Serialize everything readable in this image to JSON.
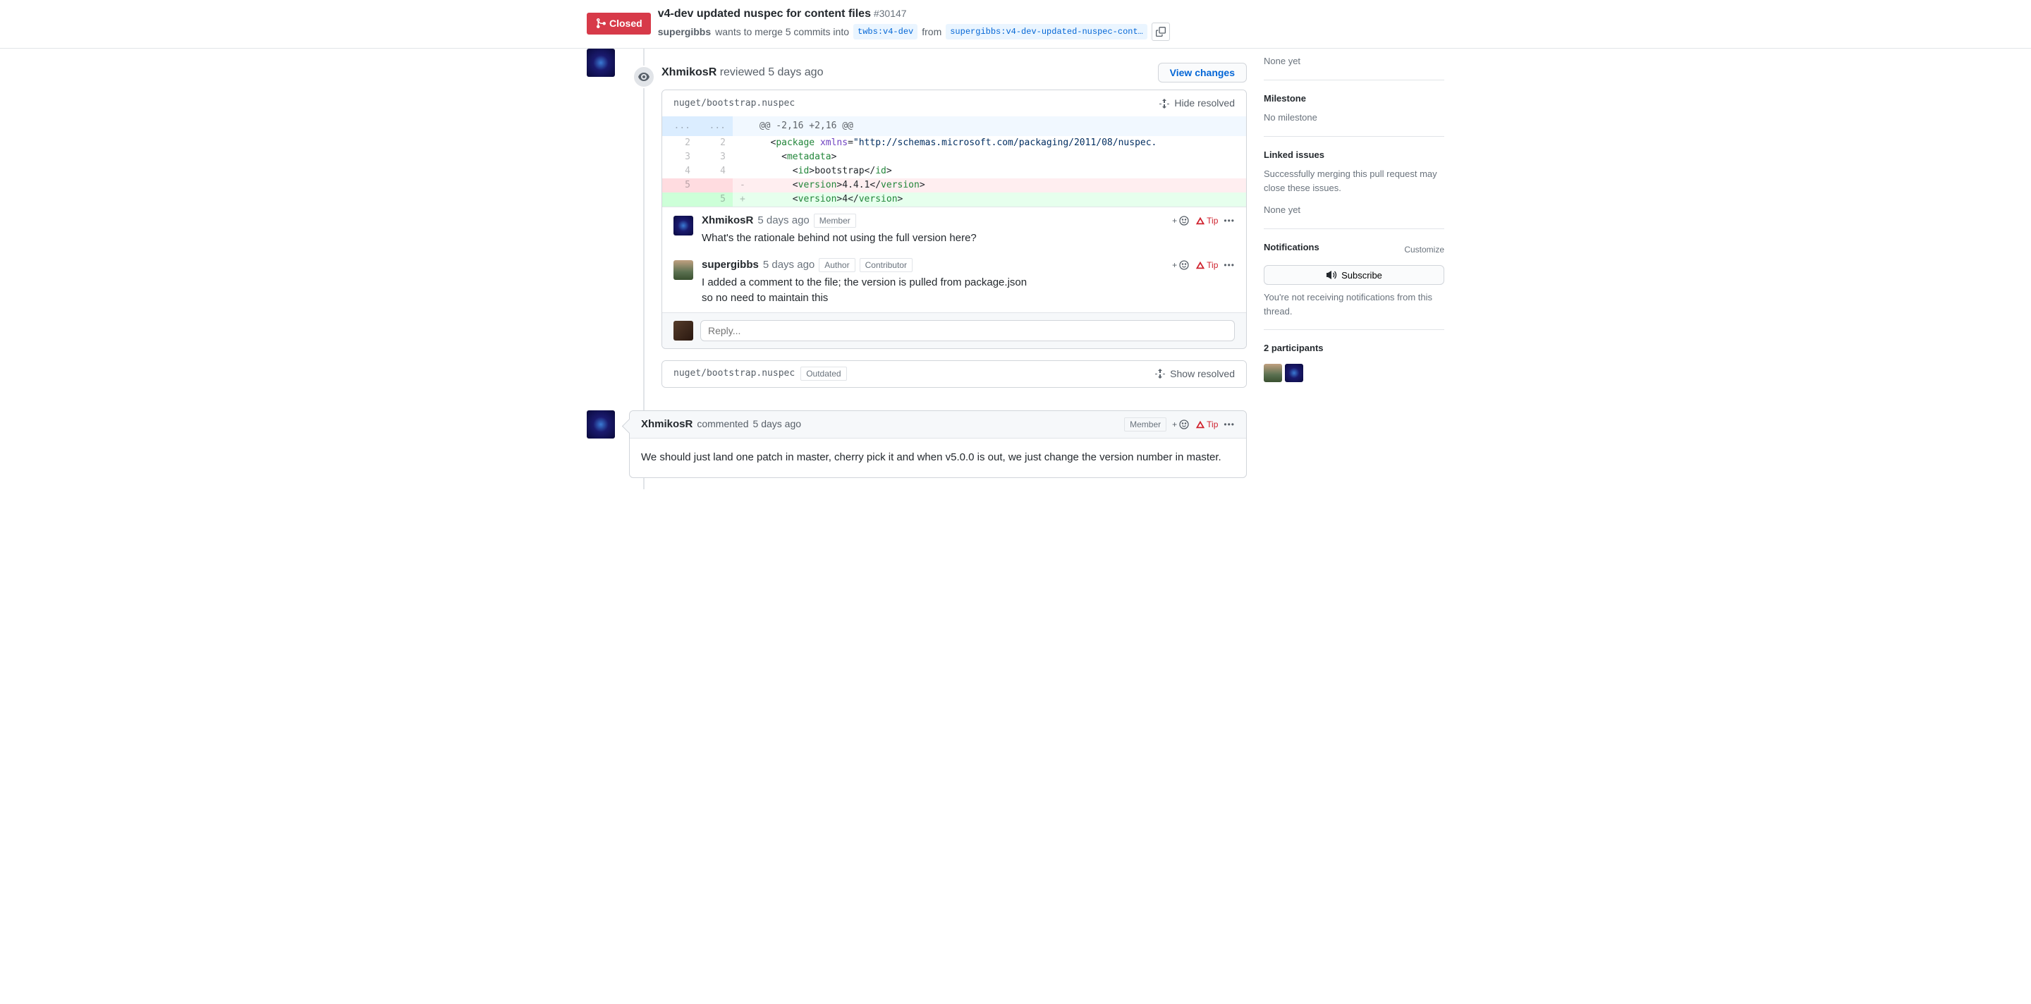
{
  "header": {
    "state": "Closed",
    "title": "v4-dev updated nuspec for content files",
    "pr_number": "#30147",
    "author": "supergibbs",
    "wants_text": "wants to merge 5 commits into",
    "base_branch": "twbs:v4-dev",
    "from_text": "from",
    "head_branch": "supergibbs:v4-dev-updated-nuspec-cont…"
  },
  "review": {
    "author": "XhmikosR",
    "action": "reviewed",
    "timestamp": "5 days ago",
    "view_changes": "View changes",
    "file": "nuget/bootstrap.nuspec",
    "hide_resolved": "Hide resolved",
    "hunk_header": "@@ -2,16 +2,16 @@",
    "comments": [
      {
        "author": "XhmikosR",
        "timestamp": "5 days ago",
        "badges": [
          "Member"
        ],
        "text": "What's the rationale behind not using the full version here?",
        "tip": "Tip"
      },
      {
        "author": "supergibbs",
        "timestamp": "5 days ago",
        "badges": [
          "Author",
          "Contributor"
        ],
        "text": "I added a comment to the file; the version is pulled from package.json so no need to maintain this",
        "tip": "Tip"
      }
    ],
    "reply_placeholder": "Reply...",
    "outdated_file": "nuget/bootstrap.nuspec",
    "outdated_label": "Outdated",
    "show_resolved": "Show resolved"
  },
  "diff": {
    "line2_old": "2",
    "line2_new": "2",
    "line3_old": "3",
    "line3_new": "3",
    "line4_old": "4",
    "line4_new": "4",
    "line5_old": "5",
    "line5_new": "5",
    "xmlns_url": "http://schemas.microsoft.com/packaging/2011/08/nuspec.",
    "old_version": "4.4.1",
    "new_version": "4"
  },
  "comment_card": {
    "author": "XhmikosR",
    "verb": "commented",
    "timestamp": "5 days ago",
    "badge": "Member",
    "tip": "Tip",
    "body": "We should just land one patch in master, cherry pick it and when v5.0.0 is out, we just change the version number in master."
  },
  "sidebar": {
    "none_yet": "None yet",
    "milestone_title": "Milestone",
    "milestone_value": "No milestone",
    "linked_title": "Linked issues",
    "linked_desc": "Successfully merging this pull request may close these issues.",
    "linked_value": "None yet",
    "notifications_title": "Notifications",
    "customize": "Customize",
    "subscribe": "Subscribe",
    "notif_desc": "You're not receiving notifications from this thread.",
    "participants_title": "2 participants"
  }
}
